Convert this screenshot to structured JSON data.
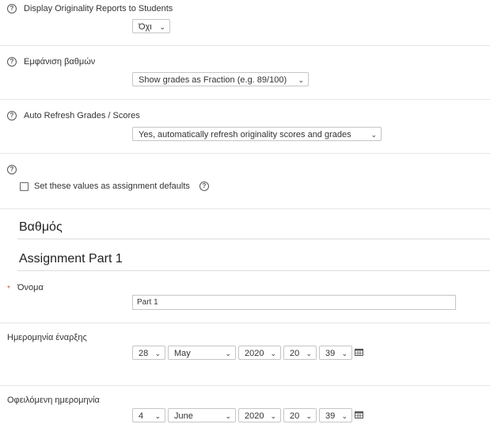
{
  "originality": {
    "label": "Display Originality Reports to Students",
    "value": "Όχι"
  },
  "grades_display": {
    "label": "Εμφάνιση βαθμών",
    "value": "Show grades as Fraction (e.g. 89/100)"
  },
  "auto_refresh": {
    "label": "Auto Refresh Grades / Scores",
    "value": "Yes, automatically refresh originality scores and grades"
  },
  "defaults": {
    "checkbox_label": "Set these values as assignment defaults"
  },
  "section_grade": {
    "title": "Βαθμός"
  },
  "section_part": {
    "title": "Assignment Part 1"
  },
  "name_field": {
    "label": "Όνομα",
    "required_mark": "*",
    "value": "Part 1"
  },
  "start_date": {
    "label": "Ημερομηνία έναρξης",
    "day": "28",
    "month": "May",
    "year": "2020",
    "hour": "20",
    "minute": "39"
  },
  "due_date": {
    "label": "Οφειλόμενη ημερομηνία",
    "day": "4",
    "month": "June",
    "year": "2020",
    "hour": "20",
    "minute": "39"
  },
  "icons": {
    "help": "help-circle-icon",
    "calendar": "calendar-icon",
    "chevron": "chevron-down-icon"
  },
  "colors": {
    "required": "#d9534f",
    "border": "#c6c6c6",
    "separator": "#e6e6e6"
  }
}
